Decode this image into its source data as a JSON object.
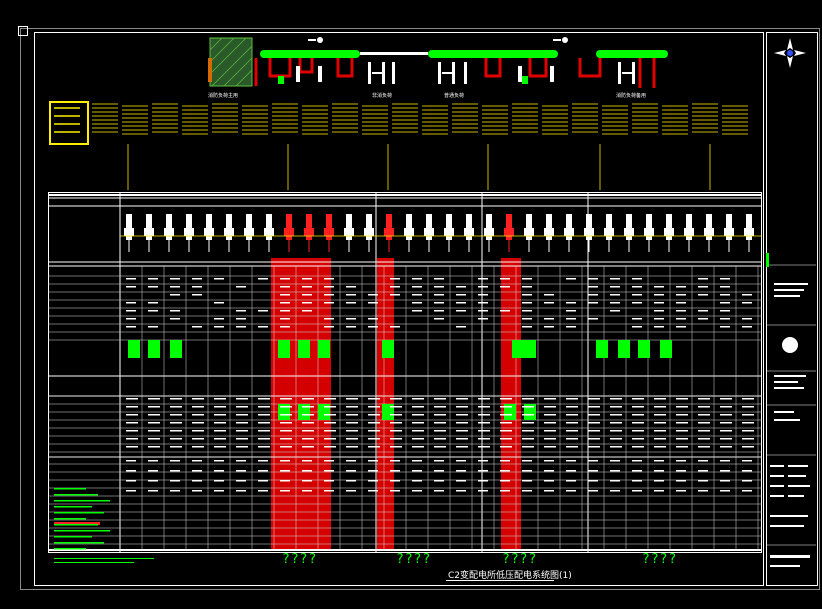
{
  "drawing": {
    "title": "C2变配电所低压配电系统图(1)",
    "column_group_marks": [
      "????",
      "????",
      "????",
      "????"
    ],
    "top_captions": [
      "消防负荷主用",
      "非消负荷",
      "普通负荷",
      "消防负荷备用"
    ],
    "colors": {
      "background": "#000000",
      "line": "#ffffff",
      "bus": "#00ff00",
      "highlight": "#d40000",
      "text_yellow": "#ffff00",
      "callout_box": "#ffee00"
    },
    "icons": [
      "north-arrow-icon",
      "company-logo-icon",
      "transformer-icon",
      "breaker-icon"
    ]
  }
}
